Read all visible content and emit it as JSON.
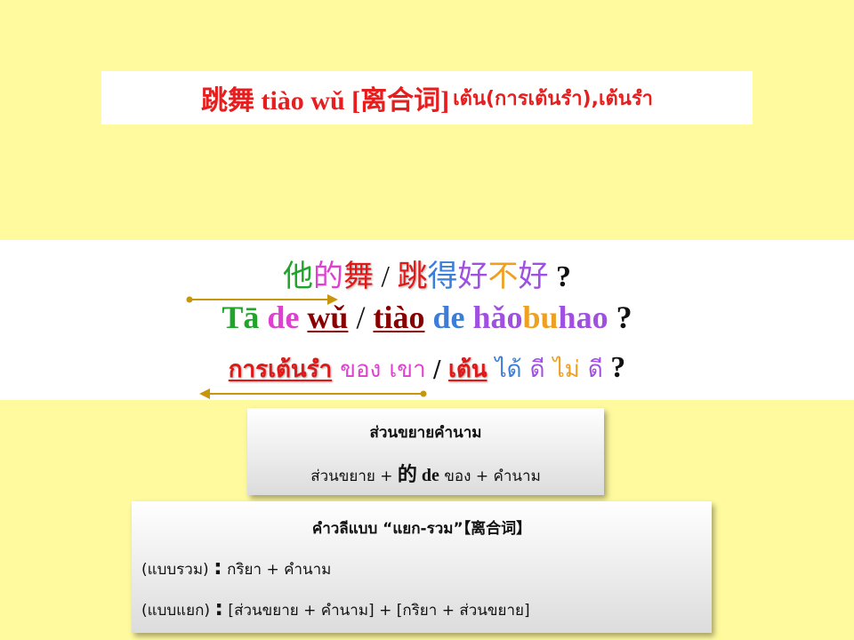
{
  "title": {
    "hanzi": "跳舞 tiào wǔ [离合词]",
    "thai_main": "เต้น",
    "thai_paren": "(การเต้นรำ), ",
    "thai_end": "เต้นรำ"
  },
  "sentence_cn": {
    "ta": "他",
    "de1": "的",
    "wu": "舞",
    "slash": " / ",
    "tiao": "跳",
    "de2": "得",
    "hao1": "好",
    "bu": "不",
    "hao2": "好",
    "q": " ?"
  },
  "sentence_py": {
    "ta": "Tā",
    "de1": "de",
    "wu": "wǔ",
    "slash": " / ",
    "tiao": "tiào",
    "de2": "de",
    "hao": "hǎo",
    "bu": "bu",
    "hao2": "hao",
    "q": " ?"
  },
  "sentence_th": {
    "dance": "การเต้นรำ",
    "khong": "ของ",
    "khao": "เขา",
    "slash": " / ",
    "ten": "เต้น",
    "dai": "ได้",
    "di1": "ดี",
    "mai": "ไม่",
    "di2": "ดี",
    "q": " ?"
  },
  "box_modifier": {
    "heading": "ส่วนขยายคำนาม",
    "part1": "ส่วนขยาย + ",
    "cn": "的",
    "de": " de",
    "part2": " ของ + คำนาม"
  },
  "box_lihe": {
    "heading": "คำวลีแบบ “แยก-รวม”【离合词】",
    "row1_label": "(แบบรวม) ",
    "row1_colon": ":",
    "row1_text": " กริยา + คำนาม",
    "row2_label": "(แบบแยก) ",
    "row2_colon": ":",
    "row2_text": " [ส่วนขยาย + คำนาม] + [กริยา + ส่วนขยาย]"
  },
  "colors": {
    "background": "#fffa9e",
    "title_red": "#e81e1e",
    "green": "#1fa52a",
    "magenta": "#e040d0",
    "red": "#e01818",
    "blue": "#3b7dd8",
    "purple": "#a050e0",
    "orange": "#f0a020",
    "arrow": "#c8960c"
  }
}
